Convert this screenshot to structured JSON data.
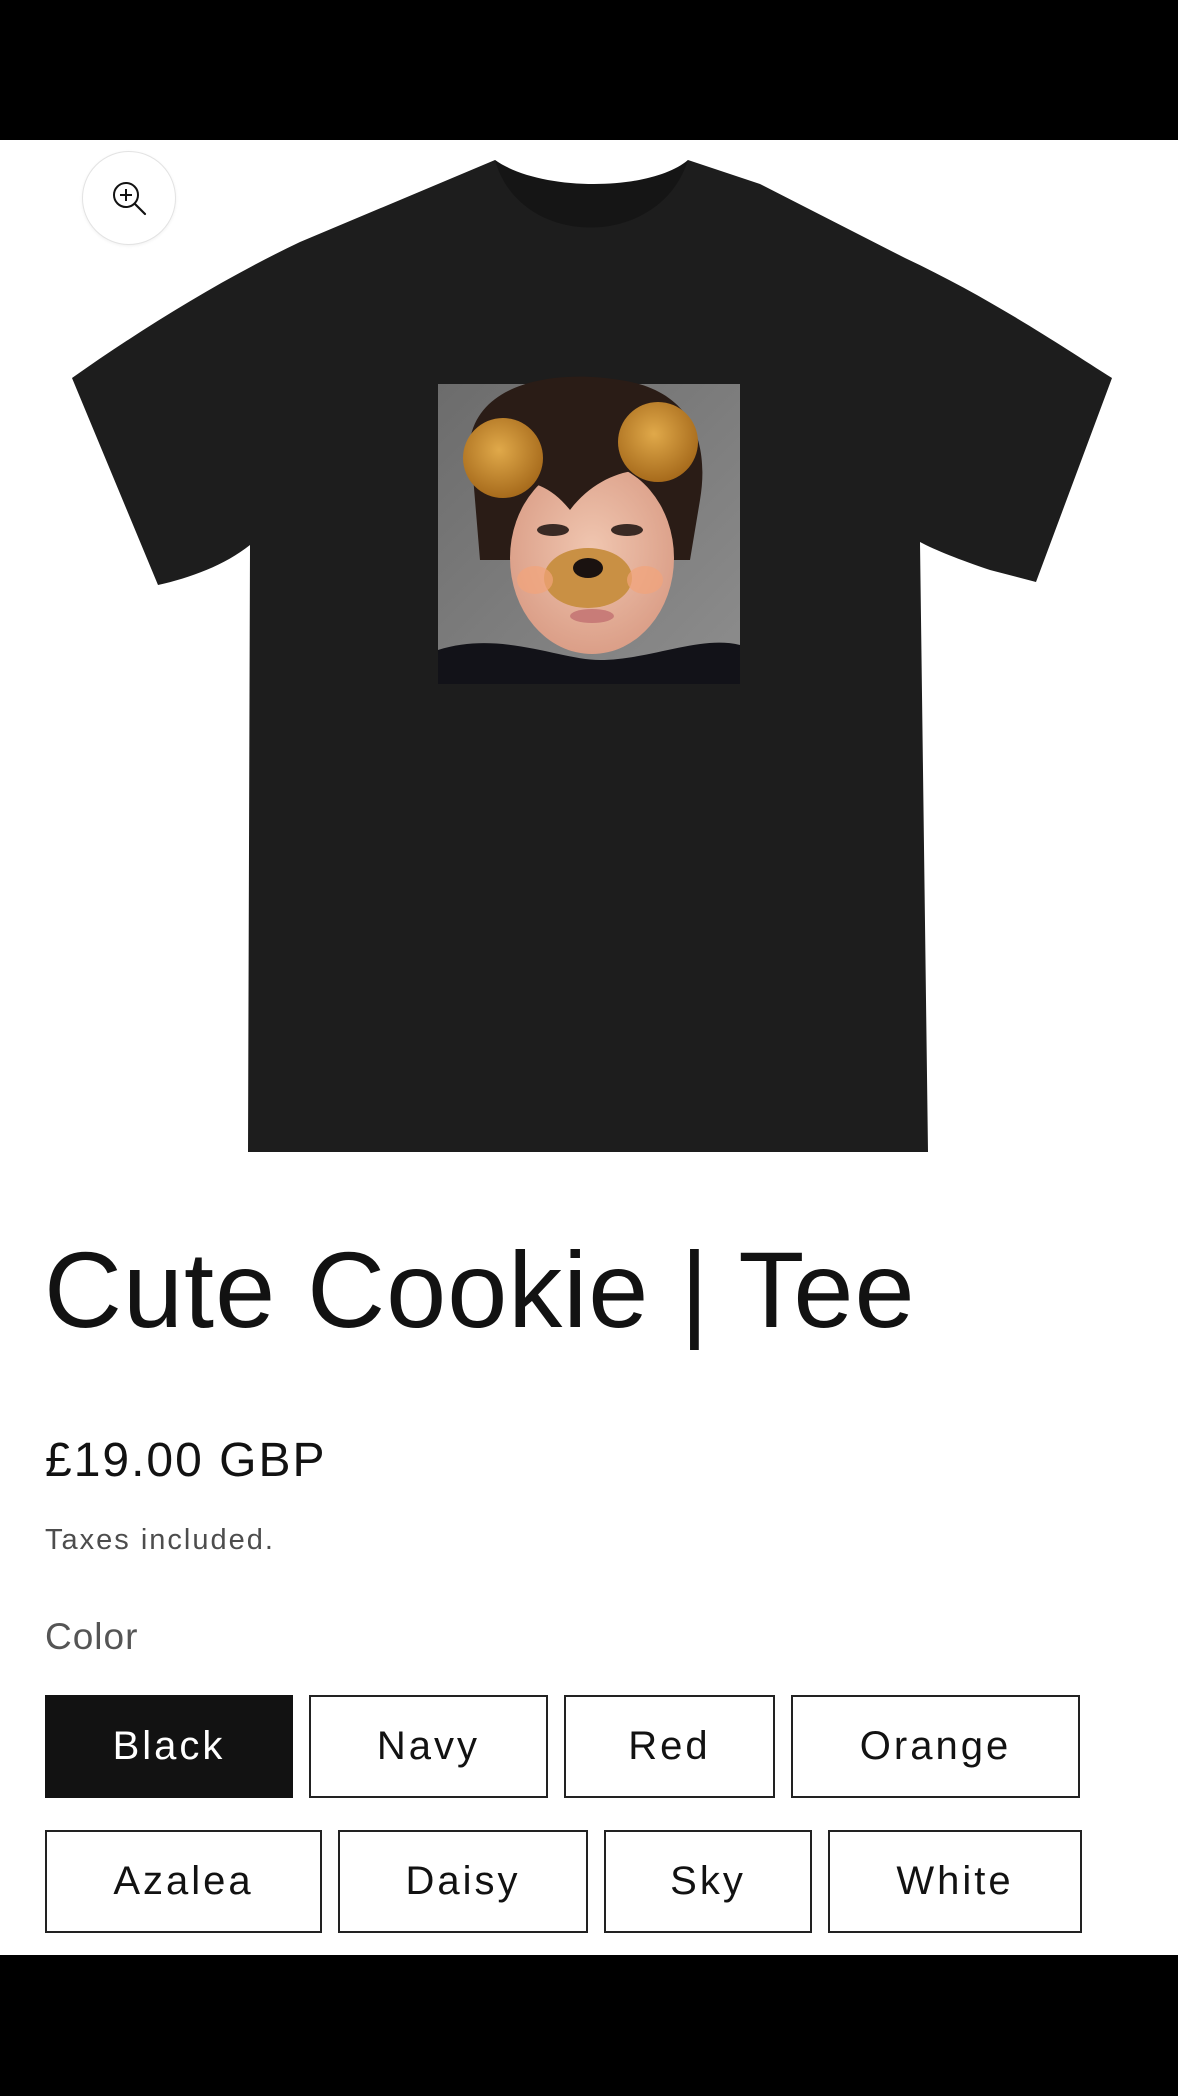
{
  "product": {
    "title": "Cute Cookie | Tee",
    "price": "£19.00 GBP",
    "tax_note": "Taxes included.",
    "garment_color": "#1d1d1d"
  },
  "media": {
    "zoom_icon": "zoom-in-icon"
  },
  "variant": {
    "label": "Color",
    "selected": "Black",
    "options": [
      "Black",
      "Navy",
      "Red",
      "Orange",
      "Azalea",
      "Daisy",
      "Sky",
      "White"
    ]
  },
  "colors": {
    "selected_bg": "#121212",
    "text": "#121212",
    "muted": "#4d4d4d"
  }
}
